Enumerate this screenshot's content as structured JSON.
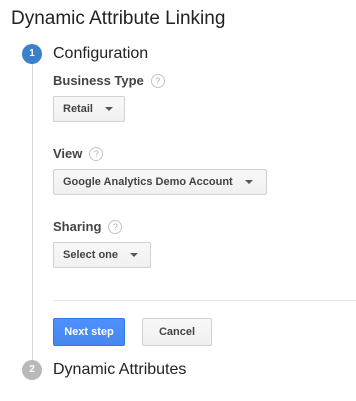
{
  "page": {
    "title": "Dynamic Attribute Linking"
  },
  "steps": [
    {
      "number": "1",
      "title": "Configuration",
      "state": "active"
    },
    {
      "number": "2",
      "title": "Dynamic Attributes",
      "state": "inactive"
    }
  ],
  "fields": {
    "business_type": {
      "label": "Business Type",
      "selected": "Retail"
    },
    "view": {
      "label": "View",
      "selected": "Google Analytics Demo Account"
    },
    "sharing": {
      "label": "Sharing",
      "selected": "Select one"
    }
  },
  "help_icon_glyph": "?",
  "actions": {
    "next_label": "Next step",
    "cancel_label": "Cancel"
  },
  "colors": {
    "accent": "#4d90fe",
    "active_step": "#3b80c8",
    "inactive_step": "#b9b9b9"
  },
  "icons": {
    "help": "question-circle-icon",
    "dropdown": "chevron-down-icon"
  }
}
